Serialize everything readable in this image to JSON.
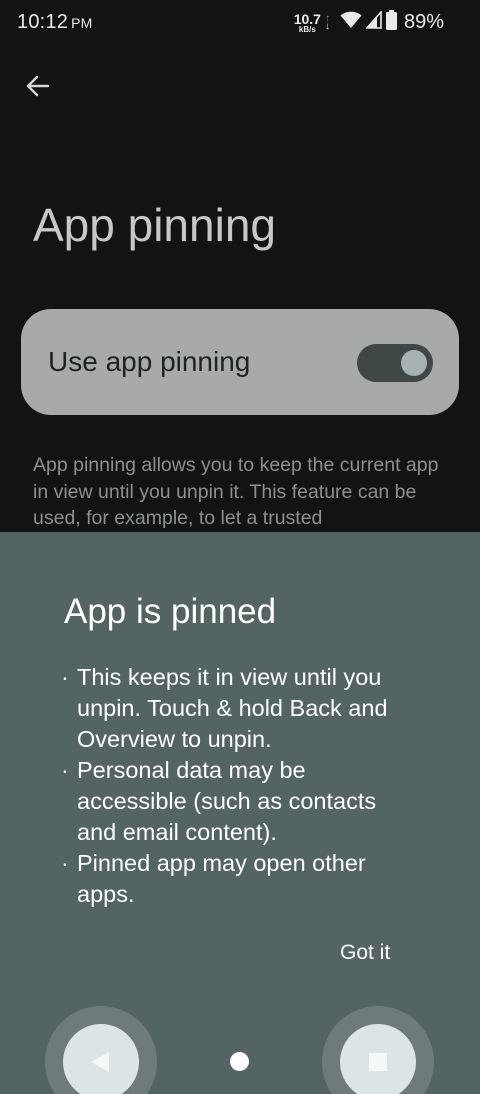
{
  "status_bar": {
    "time": "10:12",
    "ampm": "PM",
    "net_speed_value": "10.7",
    "net_speed_unit": "kB/s",
    "battery_percent": "89%"
  },
  "settings": {
    "title": "App pinning",
    "toggle_label": "Use app pinning",
    "toggle_on": true,
    "description": "App pinning allows you to keep the current app in view until you unpin it. This feature can be used, for example, to let a trusted"
  },
  "sheet": {
    "title": "App is pinned",
    "bullets": [
      "This keeps it in view until you unpin. Touch & hold Back and Overview to unpin.",
      "Personal data may be accessible (such as contacts and email content).",
      "Pinned app may open other apps."
    ],
    "button_label": "Got it"
  },
  "icons": {
    "back": "arrow-back-icon",
    "wifi": "wifi-icon",
    "signal": "cell-signal-icon",
    "battery": "battery-icon",
    "nav_back": "nav-back-icon",
    "nav_home": "nav-home-icon",
    "nav_recents": "nav-recents-icon"
  },
  "colors": {
    "sheet_background": "#546463",
    "card_background": "#a8aaaa",
    "toggle_track": "#3f4747"
  }
}
